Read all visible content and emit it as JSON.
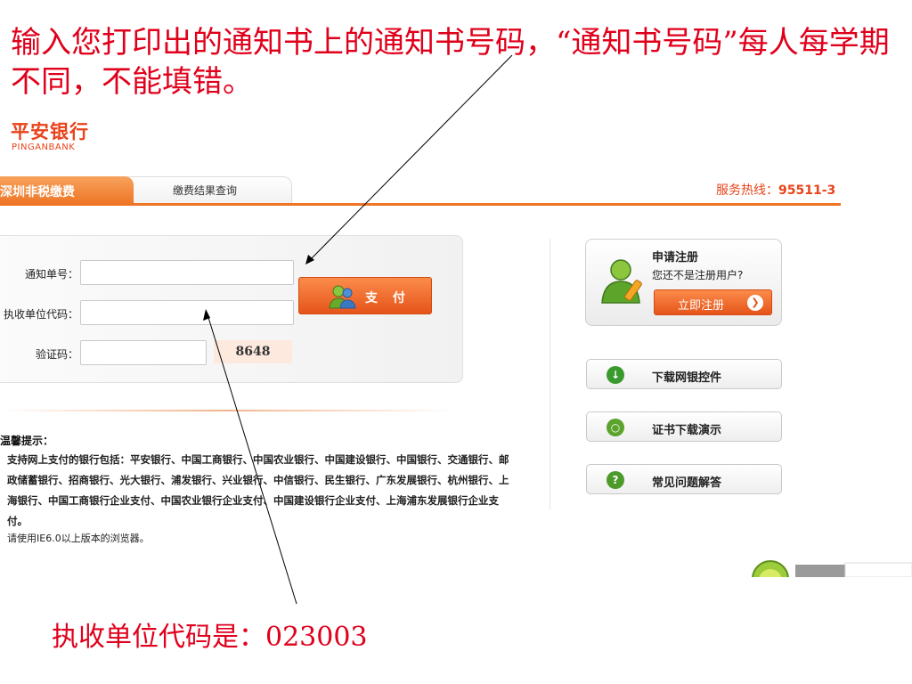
{
  "annotations": {
    "top_note": "输入您打印出的通知书上的通知书号码，“通知书号码”每人每学期不同，不能填错。",
    "bottom_note": "执收单位代码是：023003"
  },
  "logo": {
    "name_cn": "平安银行",
    "name_en": "PINGANBANK"
  },
  "tabs": [
    {
      "label": "深圳非税缴费",
      "active": true
    },
    {
      "label": "缴费结果查询",
      "active": false
    }
  ],
  "hotline": {
    "label": "服务热线：",
    "number": "95511-3"
  },
  "form": {
    "notice_no_label": "通知单号：",
    "notice_no_value": "",
    "unit_code_label": "执收单位代码：",
    "unit_code_value": "",
    "captcha_label": "验证码：",
    "captcha_value": "",
    "captcha_image_text": "8648",
    "pay_button_label": "支 付"
  },
  "notice": {
    "title": "温馨提示：",
    "body": "支持网上支付的银行包括：平安银行、中国工商银行、中国农业银行、中国建设银行、中国银行、交通银行、邮政储蓄银行、招商银行、光大银行、浦发银行、兴业银行、中信银行、民生银行、广东发展银行、杭州银行、上海银行、中国工商银行企业支付、中国农业银行企业支付、中国建设银行企业支付、上海浦东发展银行企业支付。",
    "browser_tip": "请使用IE6.0以上版本的浏览器。"
  },
  "register": {
    "title": "申请注册",
    "subtitle": "您还不是注册用户?",
    "button_label": "立即注册"
  },
  "side_buttons": [
    {
      "label": "下载网银控件",
      "icon": "download-icon",
      "color": "#3a9a2e"
    },
    {
      "label": "证书下载演示",
      "icon": "search-icon",
      "color": "#5aa32c"
    },
    {
      "label": "常见问题解答",
      "icon": "help-icon",
      "color": "#4c9a2a"
    }
  ],
  "colors": {
    "accent": "#ee7524",
    "annotation": "#e0001b"
  }
}
